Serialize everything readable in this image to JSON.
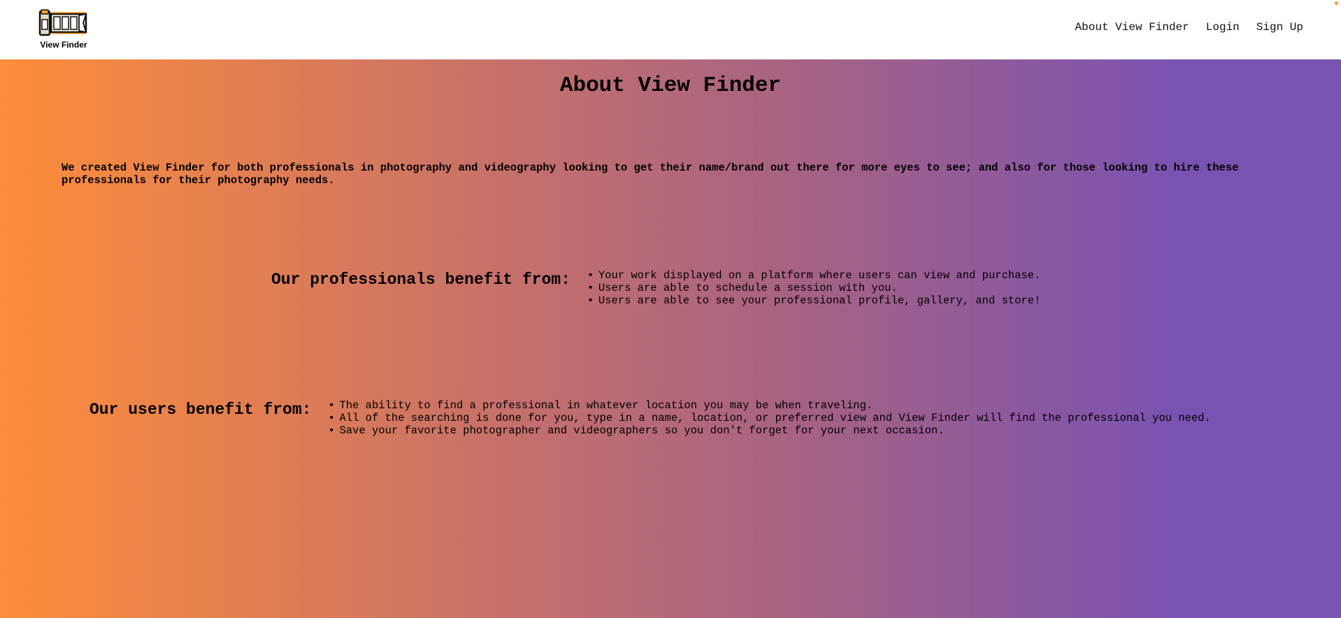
{
  "header": {
    "logo_text": "View Finder",
    "nav": [
      {
        "label": "About View Finder"
      },
      {
        "label": "Login"
      },
      {
        "label": "Sign Up"
      }
    ]
  },
  "main": {
    "title": "About View Finder",
    "intro": "We created View Finder for both professionals in photography and videography looking to get their name/brand out there for more eyes to see; and also for those looking to hire these professionals for their photography needs.",
    "professionals": {
      "heading": "Our professionals benefit from:",
      "items": [
        "Your work displayed on a platform where users can view and purchase.",
        "Users are able to schedule a session with you.",
        "Users are able to see your professional profile, gallery, and store!"
      ]
    },
    "users": {
      "heading": "Our users benefit from:",
      "items": [
        "The ability to find a professional in whatever location you may be when traveling.",
        "All of the searching is done for you, type in a name, location, or preferred view and View Finder will find the professional you need.",
        "Save your favorite photographer and videographers so you don't forget for your next occasion."
      ]
    }
  },
  "colors": {
    "gradient_start": "#fd8d3a",
    "gradient_end": "#7a52b2",
    "header_bg": "#ffffff"
  }
}
